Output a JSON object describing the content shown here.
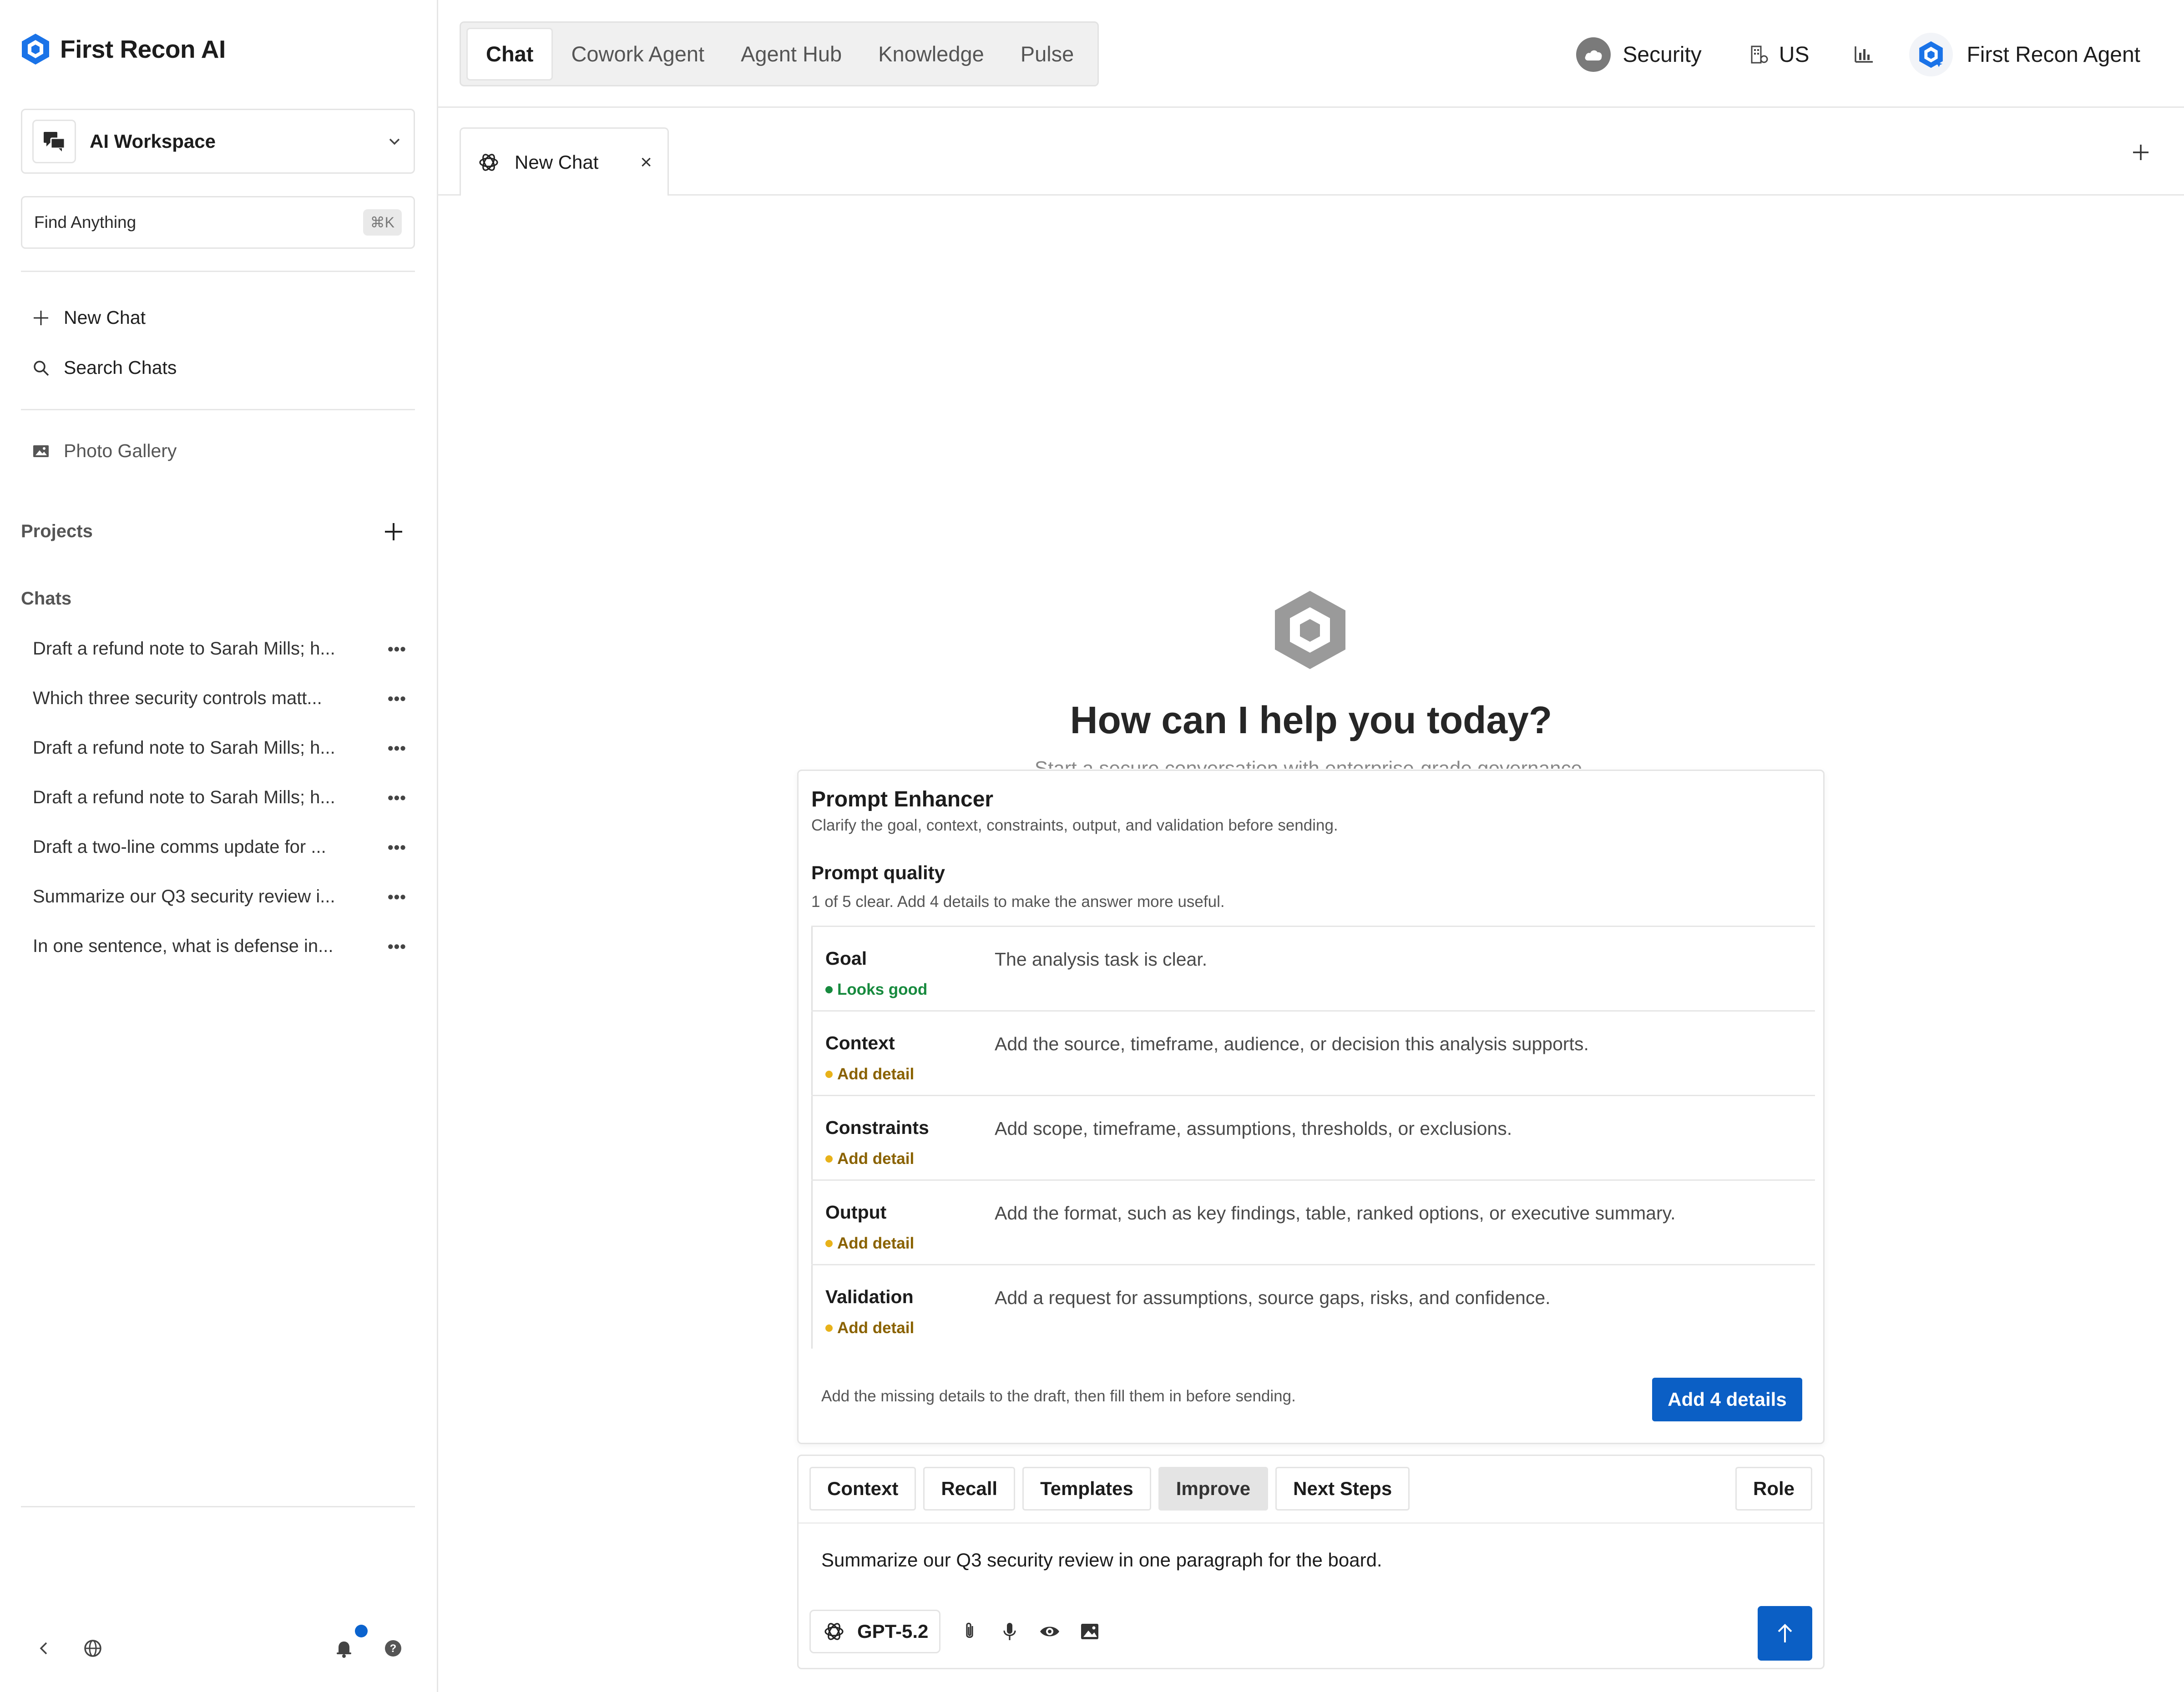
{
  "app": {
    "name": "First Recon AI",
    "brand_color": "#0b5fc5"
  },
  "sidebar": {
    "workspace_label": "AI Workspace",
    "find_label": "Find Anything",
    "find_shortcut": "⌘K",
    "new_chat": "New Chat",
    "search_chats": "Search Chats",
    "photo_gallery": "Photo Gallery",
    "projects_title": "Projects",
    "chats_title": "Chats",
    "chats": [
      {
        "title": "Draft a refund note to Sarah Mills; h..."
      },
      {
        "title": "Which three security controls matt..."
      },
      {
        "title": "Draft a refund note to Sarah Mills; h..."
      },
      {
        "title": "Draft a refund note to Sarah Mills; h..."
      },
      {
        "title": "Draft a two-line comms update for ..."
      },
      {
        "title": "Summarize our Q3 security review i..."
      },
      {
        "title": "In one sentence, what is defense in..."
      }
    ],
    "more_glyph": "•••"
  },
  "topbar": {
    "tabs": [
      "Chat",
      "Cowork Agent",
      "Agent Hub",
      "Knowledge",
      "Pulse"
    ],
    "security": "Security",
    "region": "US",
    "agent": "First Recon Agent"
  },
  "chat_tab": {
    "label": "New Chat",
    "close": "×"
  },
  "hero": {
    "title": "How can I help you today?",
    "subtitle": "Start a secure conversation with enterprise-grade governance."
  },
  "enhancer": {
    "title": "Prompt Enhancer",
    "subtitle": "Clarify the goal, context, constraints, output, and validation before sending.",
    "quality_title": "Prompt quality",
    "quality_sub": "1 of 5 clear. Add 4 details to make the answer more useful.",
    "rows": [
      {
        "label": "Goal",
        "status": "Looks good",
        "desc": "The analysis task is clear."
      },
      {
        "label": "Context",
        "status": "Add detail",
        "desc": "Add the source, timeframe, audience, or decision this analysis supports."
      },
      {
        "label": "Constraints",
        "status": "Add detail",
        "desc": "Add scope, timeframe, assumptions, thresholds, or exclusions."
      },
      {
        "label": "Output",
        "status": "Add detail",
        "desc": "Add the format, such as key findings, table, ranked options, or executive summary."
      },
      {
        "label": "Validation",
        "status": "Add detail",
        "desc": "Add a request for assumptions, source gaps, risks, and confidence."
      }
    ],
    "footer": "Add the missing details to the draft, then fill them in before sending.",
    "button": "Add 4 details"
  },
  "composer": {
    "tabs": [
      "Context",
      "Recall",
      "Templates",
      "Improve",
      "Next Steps"
    ],
    "active_tab": "Improve",
    "role": "Role",
    "text": "Summarize our Q3 security review in one paragraph for the board.",
    "model": "GPT-5.2"
  }
}
